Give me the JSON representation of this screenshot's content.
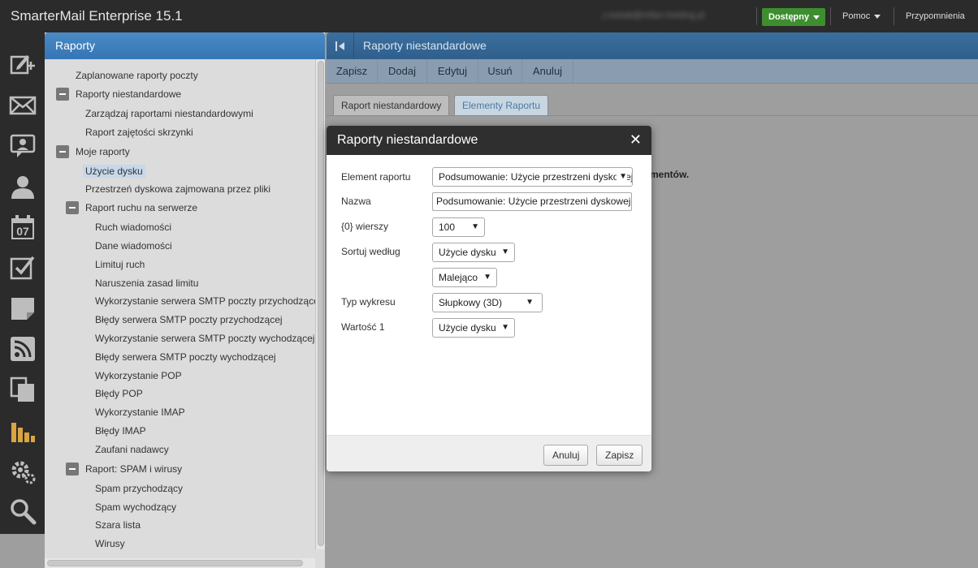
{
  "app": {
    "title": "SmarterMail Enterprise 15.1"
  },
  "topbar": {
    "user_email": "j.nowak@milan-hosting.pl",
    "status_label": "Dostępny",
    "help_label": "Pomoc",
    "reminders_label": "Przypomnienia",
    "status_color": "#3e8e2f"
  },
  "rail": {
    "icons": [
      "compose-icon",
      "mail-icon",
      "chat-icon",
      "contacts-icon",
      "calendar-icon",
      "tasks-icon",
      "notes-icon",
      "rss-icon",
      "files-icon",
      "reports-icon",
      "settings-icon",
      "search-icon"
    ],
    "calendar_day": "07"
  },
  "left_panel": {
    "title": "Raporty",
    "tree": [
      {
        "label": "Zaplanowane raporty poczty"
      },
      {
        "label": "Raporty niestandardowe"
      },
      {
        "label": "Zarządzaj raportami niestandardowymi"
      },
      {
        "label": "Raport zajętości skrzynki"
      },
      {
        "label": "Moje raporty"
      },
      {
        "label": "Użycie dysku"
      },
      {
        "label": "Przestrzeń dyskowa zajmowana przez pliki"
      },
      {
        "label": "Raport ruchu na serwerze"
      },
      {
        "label": "Ruch wiadomości"
      },
      {
        "label": "Dane wiadomości"
      },
      {
        "label": "Limituj ruch"
      },
      {
        "label": "Naruszenia zasad limitu"
      },
      {
        "label": "Wykorzystanie serwera SMTP poczty przychodzącej"
      },
      {
        "label": "Błędy serwera SMTP poczty przychodzącej"
      },
      {
        "label": "Wykorzystanie serwera SMTP poczty wychodzącej"
      },
      {
        "label": "Błędy serwera SMTP poczty wychodzącej"
      },
      {
        "label": "Wykorzystanie POP"
      },
      {
        "label": "Błędy POP"
      },
      {
        "label": "Wykorzystanie IMAP"
      },
      {
        "label": "Błędy IMAP"
      },
      {
        "label": "Zaufani nadawcy"
      },
      {
        "label": "Raport: SPAM i wirusy"
      },
      {
        "label": "Spam przychodzący"
      },
      {
        "label": "Spam wychodzący"
      },
      {
        "label": "Szara lista"
      },
      {
        "label": "Wirusy"
      }
    ]
  },
  "right_panel": {
    "title": "Raporty niestandardowe",
    "toolbar": {
      "save": "Zapisz",
      "add": "Dodaj",
      "edit": "Edytuj",
      "delete": "Usuń",
      "cancel": "Anuluj"
    },
    "tabs": [
      "Raport niestandardowy",
      "Elementy Raportu"
    ],
    "background_text": "mentów."
  },
  "modal": {
    "title": "Raporty niestandardowe",
    "labels": {
      "element": "Element raportu",
      "name": "Nazwa",
      "rows": "{0} wierszy",
      "sort_by": "Sortuj według",
      "chart_type": "Typ wykresu",
      "value1": "Wartość 1"
    },
    "values": {
      "element": "Podsumowanie: Użycie przestrzeni dyskowej",
      "name": "Podsumowanie: Użycie przestrzeni dyskowej",
      "rows": "100",
      "sort_by": "Użycie dysku",
      "sort_order": "Malejąco",
      "chart_type": "Słupkowy (3D)",
      "value1": "Użycie dysku"
    },
    "buttons": {
      "cancel": "Anuluj",
      "save": "Zapisz"
    }
  }
}
